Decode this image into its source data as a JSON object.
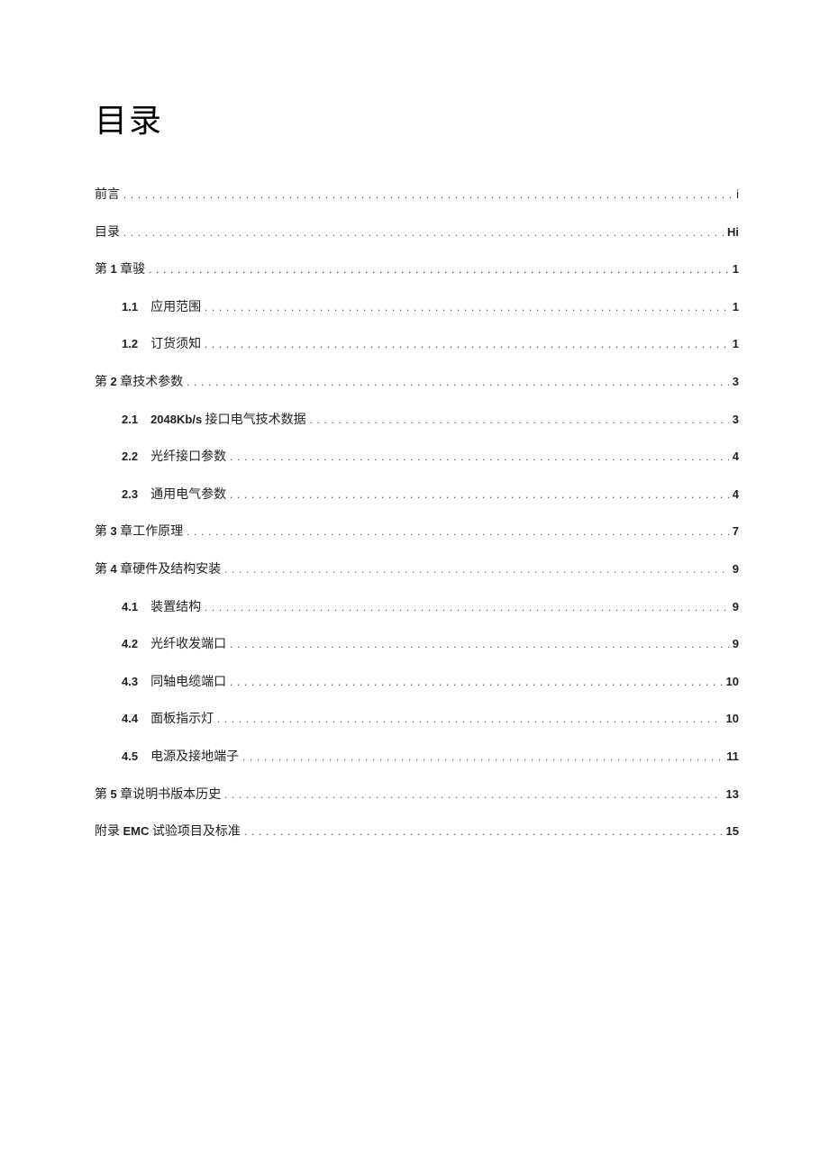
{
  "title": "目录",
  "entries": [
    {
      "level": 0,
      "num": "",
      "label": "前言",
      "page": "i",
      "pageClass": "roman"
    },
    {
      "level": 0,
      "num": "",
      "label": "目录",
      "page": "Hi",
      "pageClass": ""
    },
    {
      "level": 0,
      "num": "",
      "label_html": "第 <span class='toc-label-part'>1</span> 章骏",
      "page": "1",
      "pageClass": ""
    },
    {
      "level": 1,
      "num": "1.1",
      "label": "应用范围",
      "page": "1",
      "pageClass": ""
    },
    {
      "level": 1,
      "num": "1.2",
      "label": "订货须知",
      "page": "1",
      "pageClass": ""
    },
    {
      "level": 0,
      "num": "",
      "label_html": "第 <span class='toc-label-part'>2</span> 章技术参数",
      "page": "3",
      "pageClass": ""
    },
    {
      "level": 1,
      "num": "2.1",
      "label_html": "<span class='toc-label-part'>2048Kb/s</span> 接口电气技术数据",
      "page": "3",
      "pageClass": ""
    },
    {
      "level": 1,
      "num": "2.2",
      "label": "光纤接口参数",
      "page": "4",
      "pageClass": ""
    },
    {
      "level": 1,
      "num": "2.3",
      "label": "通用电气参数",
      "page": "4",
      "pageClass": ""
    },
    {
      "level": 0,
      "num": "",
      "label_html": "第 <span class='toc-label-part'>3</span> 章工作原理",
      "page": "7",
      "pageClass": ""
    },
    {
      "level": 0,
      "num": "",
      "label_html": "第 <span class='toc-label-part'>4</span> 章硬件及结构安装",
      "page": "9",
      "pageClass": ""
    },
    {
      "level": 1,
      "num": "4.1",
      "label": "装置结构",
      "page": "9",
      "pageClass": ""
    },
    {
      "level": 1,
      "num": "4.2",
      "label": "光纤收发端口",
      "page": "9",
      "pageClass": ""
    },
    {
      "level": 1,
      "num": "4.3",
      "label": "同轴电缆端口",
      "page": "10",
      "pageClass": ""
    },
    {
      "level": 1,
      "num": "4.4",
      "label": "面板指示灯",
      "page": "10",
      "pageClass": ""
    },
    {
      "level": 1,
      "num": "4.5",
      "label": "电源及接地端子",
      "page": "11",
      "pageClass": ""
    },
    {
      "level": 0,
      "num": "",
      "label_html": "第 <span class='toc-label-part'>5</span> 章说明书版本历史",
      "page": "13",
      "pageClass": ""
    },
    {
      "level": 0,
      "num": "",
      "label_html": "附录 <span class='toc-label-part'>EMC</span> 试验项目及标准",
      "page": "15",
      "pageClass": ""
    }
  ]
}
